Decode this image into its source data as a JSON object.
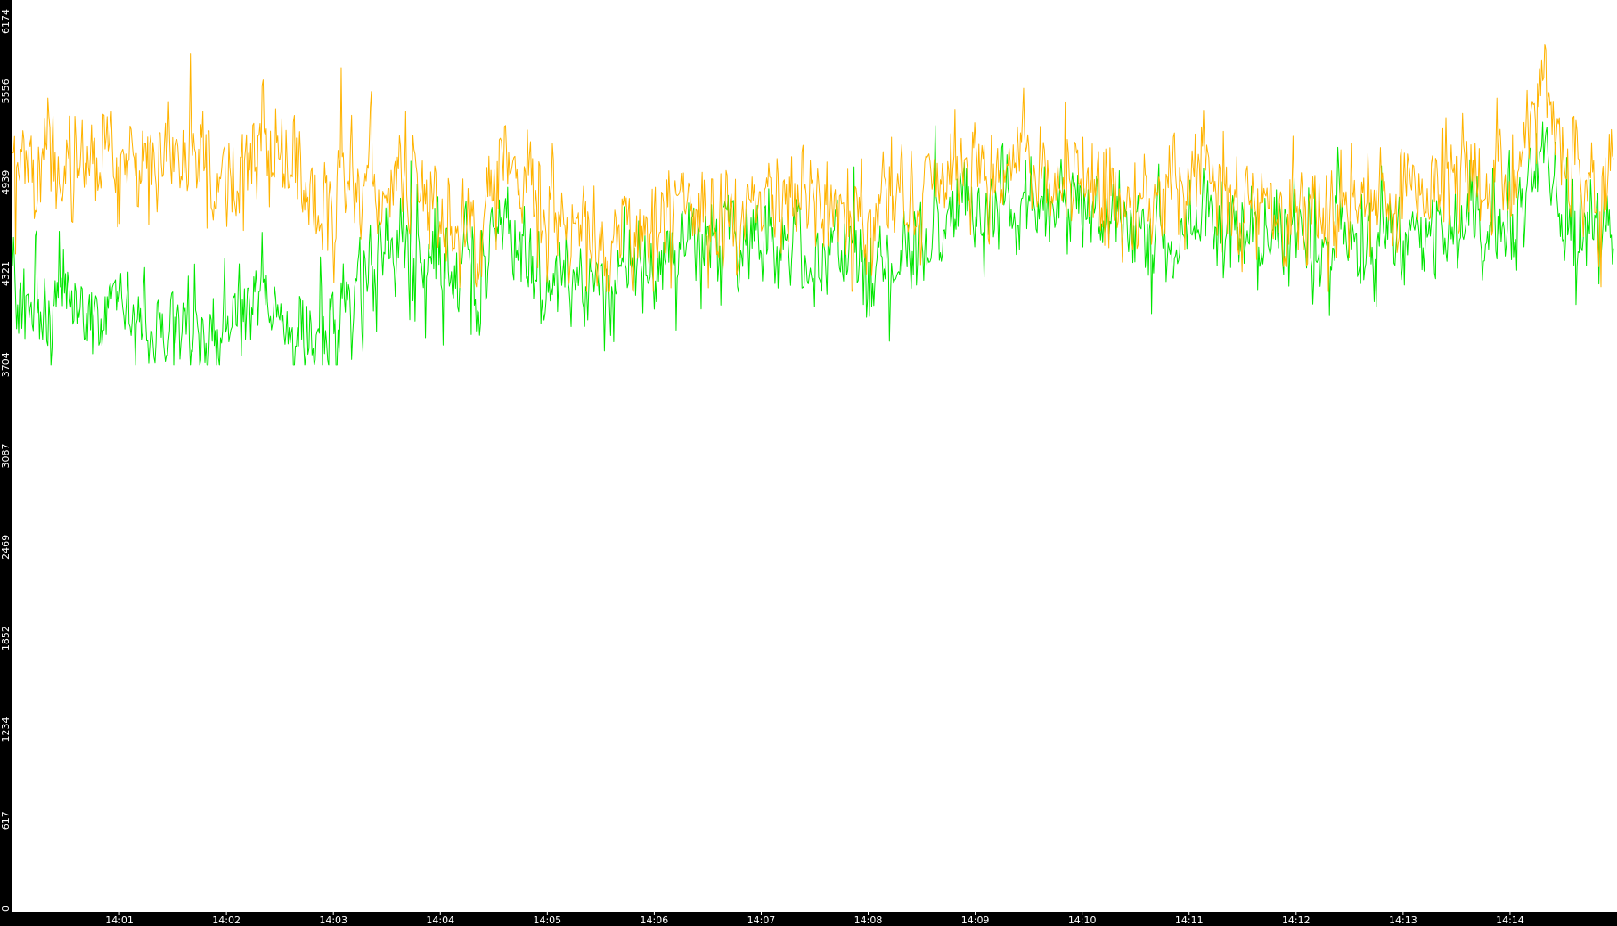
{
  "chart_data": {
    "type": "line",
    "title": "",
    "xlabel": "",
    "ylabel": "",
    "ylim": [
      0,
      6174
    ],
    "y_ticks": [
      0,
      617,
      1234,
      1852,
      2469,
      3087,
      3704,
      4321,
      4939,
      5556,
      6174
    ],
    "x_time_range": [
      "14:00",
      "14:15"
    ],
    "x_ticks": [
      "14:01",
      "14:02",
      "14:03",
      "14:04",
      "14:05",
      "14:06",
      "14:07",
      "14:08",
      "14:09",
      "14:10",
      "14:11",
      "14:12",
      "14:13",
      "14:14"
    ],
    "x_tick_values": [
      "14:01",
      "14:02",
      "14:03",
      "14:04",
      "14:05",
      "14:06",
      "14:07",
      "14:08",
      "14:09",
      "14:10",
      "14:11",
      "14:12",
      "14:13",
      "14:14"
    ],
    "series": [
      {
        "color": "#ffb300",
        "x": [
          "14:00",
          "14:00:30",
          "14:01",
          "14:01:30",
          "14:02",
          "14:02:20",
          "14:02:40",
          "14:03",
          "14:03:30",
          "14:04",
          "14:04:20",
          "14:04:35",
          "14:05",
          "14:05:40",
          "14:06",
          "14:06:30",
          "14:07",
          "14:07:30",
          "14:08",
          "14:08:30",
          "14:09",
          "14:09:30",
          "14:10",
          "14:10:30",
          "14:11",
          "14:11:30",
          "14:12",
          "14:12:30",
          "14:13",
          "14:13:30",
          "14:14",
          "14:14:20",
          "14:14:30",
          "14:14:58"
        ],
        "values": [
          5050,
          5000,
          5080,
          5050,
          4950,
          5250,
          5000,
          4950,
          4950,
          4750,
          4620,
          5050,
          4780,
          4560,
          4720,
          4720,
          4820,
          4880,
          4650,
          4880,
          5020,
          5050,
          4980,
          4820,
          4950,
          4780,
          4720,
          4760,
          4860,
          4880,
          4950,
          5650,
          5100,
          4850
        ],
        "range_min": 4200,
        "range_max": 6174
      },
      {
        "color": "#00e600",
        "x": [
          "14:00",
          "14:00:30",
          "14:01",
          "14:01:30",
          "14:02",
          "14:02:20",
          "14:02:40",
          "14:03",
          "14:03:30",
          "14:04",
          "14:04:20",
          "14:04:35",
          "14:05",
          "14:05:40",
          "14:06",
          "14:06:30",
          "14:07",
          "14:07:30",
          "14:08",
          "14:08:30",
          "14:09",
          "14:09:30",
          "14:10",
          "14:10:30",
          "14:11",
          "14:11:30",
          "14:12",
          "14:12:30",
          "14:13",
          "14:13:30",
          "14:14",
          "14:14:20",
          "14:14:30",
          "14:14:58"
        ],
        "values": [
          4200,
          4050,
          4120,
          4000,
          3950,
          4250,
          4000,
          4050,
          4500,
          4380,
          4300,
          4650,
          4400,
          4250,
          4400,
          4500,
          4550,
          4520,
          4300,
          4580,
          4700,
          4820,
          4700,
          4580,
          4620,
          4600,
          4550,
          4580,
          4600,
          4650,
          4650,
          5150,
          4700,
          4550
        ],
        "range_min": 3700,
        "range_max": 5500
      }
    ],
    "grid": false,
    "legend": "none"
  }
}
